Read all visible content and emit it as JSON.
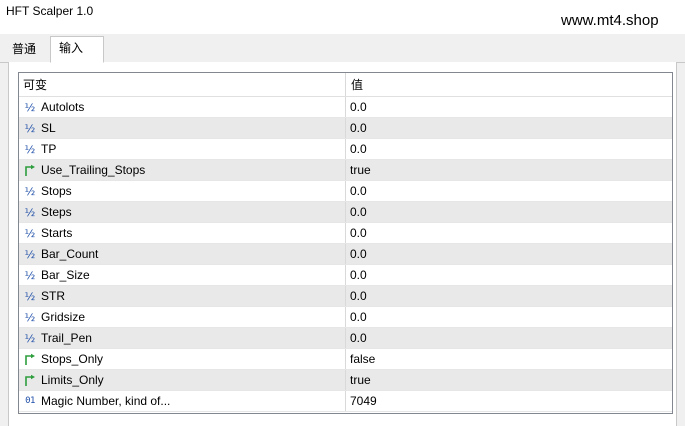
{
  "window": {
    "title": "HFT Scalper 1.0"
  },
  "watermark": "www.mt4.shop",
  "tabs": [
    {
      "label": "普通",
      "active": false
    },
    {
      "label": "输入",
      "active": true
    }
  ],
  "table": {
    "headers": {
      "name": "可变",
      "value": "值"
    },
    "rows": [
      {
        "icon": "fraction-icon",
        "name": "Autolots",
        "value": "0.0"
      },
      {
        "icon": "fraction-icon",
        "name": "SL",
        "value": "0.0"
      },
      {
        "icon": "fraction-icon",
        "name": "TP",
        "value": "0.0"
      },
      {
        "icon": "bool-arrow-icon",
        "name": "Use_Trailing_Stops",
        "value": "true"
      },
      {
        "icon": "fraction-icon",
        "name": "Stops",
        "value": "0.0"
      },
      {
        "icon": "fraction-icon",
        "name": "Steps",
        "value": "0.0"
      },
      {
        "icon": "fraction-icon",
        "name": "Starts",
        "value": "0.0"
      },
      {
        "icon": "fraction-icon",
        "name": "Bar_Count",
        "value": "0.0"
      },
      {
        "icon": "fraction-icon",
        "name": "Bar_Size",
        "value": "0.0"
      },
      {
        "icon": "fraction-icon",
        "name": "STR",
        "value": "0.0"
      },
      {
        "icon": "fraction-icon",
        "name": "Gridsize",
        "value": "0.0"
      },
      {
        "icon": "fraction-icon",
        "name": "Trail_Pen",
        "value": "0.0"
      },
      {
        "icon": "bool-arrow-icon",
        "name": "Stops_Only",
        "value": "false"
      },
      {
        "icon": "bool-arrow-icon",
        "name": "Limits_Only",
        "value": "true"
      },
      {
        "icon": "integer-icon",
        "name": "Magic Number, kind of...",
        "value": "7049"
      }
    ]
  },
  "colors": {
    "row_alt": "#e9e9e9",
    "icon_blue": "#1f4fa8",
    "icon_green": "#2e9e3e"
  }
}
